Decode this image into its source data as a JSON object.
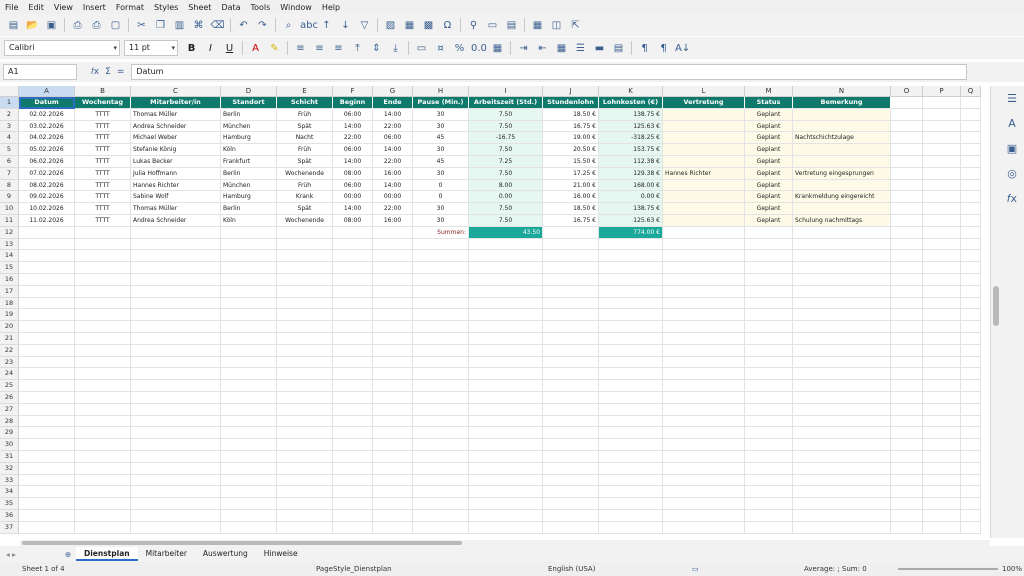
{
  "menu": [
    "File",
    "Edit",
    "View",
    "Insert",
    "Format",
    "Styles",
    "Sheet",
    "Data",
    "Tools",
    "Window",
    "Help"
  ],
  "toolbar": {
    "font_name": "Calibri",
    "font_size": "11 pt",
    "icons": [
      "new-icon",
      "open-icon",
      "save-icon",
      "export-pdf-icon",
      "print-icon",
      "print-preview-icon",
      "cut-icon",
      "copy-icon",
      "paste-icon",
      "clone-icon",
      "clear-icon",
      "undo-icon",
      "redo-icon",
      "find-icon",
      "spellcheck-icon",
      "sort-ascending-icon",
      "sort-descending-icon",
      "autofilter-icon",
      "image-icon",
      "chart-icon",
      "pivot-icon",
      "special-character-icon",
      "link-icon",
      "comment-icon",
      "header-footer-icon",
      "freeze-icon",
      "split-icon",
      "navigator-icon"
    ]
  },
  "formula": {
    "namebox": "A1",
    "content": "Datum"
  },
  "columns": [
    "A",
    "B",
    "C",
    "D",
    "E",
    "F",
    "G",
    "H",
    "I",
    "J",
    "K",
    "L",
    "M",
    "N",
    "O",
    "P",
    "Q"
  ],
  "header_row": [
    "Datum",
    "Wochentag",
    "Mitarbeiter/in",
    "Standort",
    "Schicht",
    "Beginn",
    "Ende",
    "Pause (Min.)",
    "Arbeitszeit (Std.)",
    "Stundenlohn",
    "Lohnkosten (€)",
    "Vertretung",
    "Status",
    "Bemerkung"
  ],
  "rows": [
    [
      "02.02.2026",
      "TTTT",
      "Thomas Müller",
      "Berlin",
      "Früh",
      "06:00",
      "14:00",
      "30",
      "7.50",
      "18.50 €",
      "138.75 €",
      "",
      "Geplant",
      ""
    ],
    [
      "03.02.2026",
      "TTTT",
      "Andrea Schneider",
      "München",
      "Spät",
      "14:00",
      "22:00",
      "30",
      "7.50",
      "16.75 €",
      "125.63 €",
      "",
      "Geplant",
      ""
    ],
    [
      "04.02.2026",
      "TTTT",
      "Michael Weber",
      "Hamburg",
      "Nacht",
      "22:00",
      "06:00",
      "45",
      "-16.75",
      "19.00 €",
      "-318.25 €",
      "",
      "Geplant",
      "Nachtschichtzulage"
    ],
    [
      "05.02.2026",
      "TTTT",
      "Stefanie König",
      "Köln",
      "Früh",
      "06:00",
      "14:00",
      "30",
      "7.50",
      "20.50 €",
      "153.75 €",
      "",
      "Geplant",
      ""
    ],
    [
      "06.02.2026",
      "TTTT",
      "Lukas Becker",
      "Frankfurt",
      "Spät",
      "14:00",
      "22:00",
      "45",
      "7.25",
      "15.50 €",
      "112.38 €",
      "",
      "Geplant",
      ""
    ],
    [
      "07.02.2026",
      "TTTT",
      "Julia Hoffmann",
      "Berlin",
      "Wochenende",
      "08:00",
      "16:00",
      "30",
      "7.50",
      "17.25 €",
      "129.38 €",
      "Hannes Richter",
      "Geplant",
      "Vertretung eingesprungen"
    ],
    [
      "08.02.2026",
      "TTTT",
      "Hannes Richter",
      "München",
      "Früh",
      "06:00",
      "14:00",
      "0",
      "8.00",
      "21.00 €",
      "168.00 €",
      "",
      "Geplant",
      ""
    ],
    [
      "09.02.2026",
      "TTTT",
      "Sabine Wolf",
      "Hamburg",
      "Krank",
      "00:00",
      "00:00",
      "0",
      "0.00",
      "16.00 €",
      "0.00 €",
      "",
      "Geplant",
      "Krankmeldung eingereicht"
    ],
    [
      "10.02.2026",
      "TTTT",
      "Thomas Müller",
      "Berlin",
      "Spät",
      "14:00",
      "22:00",
      "30",
      "7.50",
      "18.50 €",
      "138.75 €",
      "",
      "Geplant",
      ""
    ],
    [
      "11.02.2026",
      "TTTT",
      "Andrea Schneider",
      "Köln",
      "Wochenende",
      "08:00",
      "16:00",
      "30",
      "7.50",
      "16.75 €",
      "125.63 €",
      "",
      "Geplant",
      "Schulung nachmittags"
    ]
  ],
  "summary": {
    "label": "Summen:",
    "hours": "43.50",
    "cost": "774.00 €"
  },
  "row_count": 37,
  "sheets": [
    "Dienstplan",
    "Mitarbeiter",
    "Auswertung",
    "Hinweise"
  ],
  "status": {
    "sheet": "Sheet 1 of 4",
    "page_style": "PageStyle_Dienstplan",
    "language": "English (USA)",
    "calc": "Average: ; Sum: 0",
    "zoom": "100%"
  }
}
